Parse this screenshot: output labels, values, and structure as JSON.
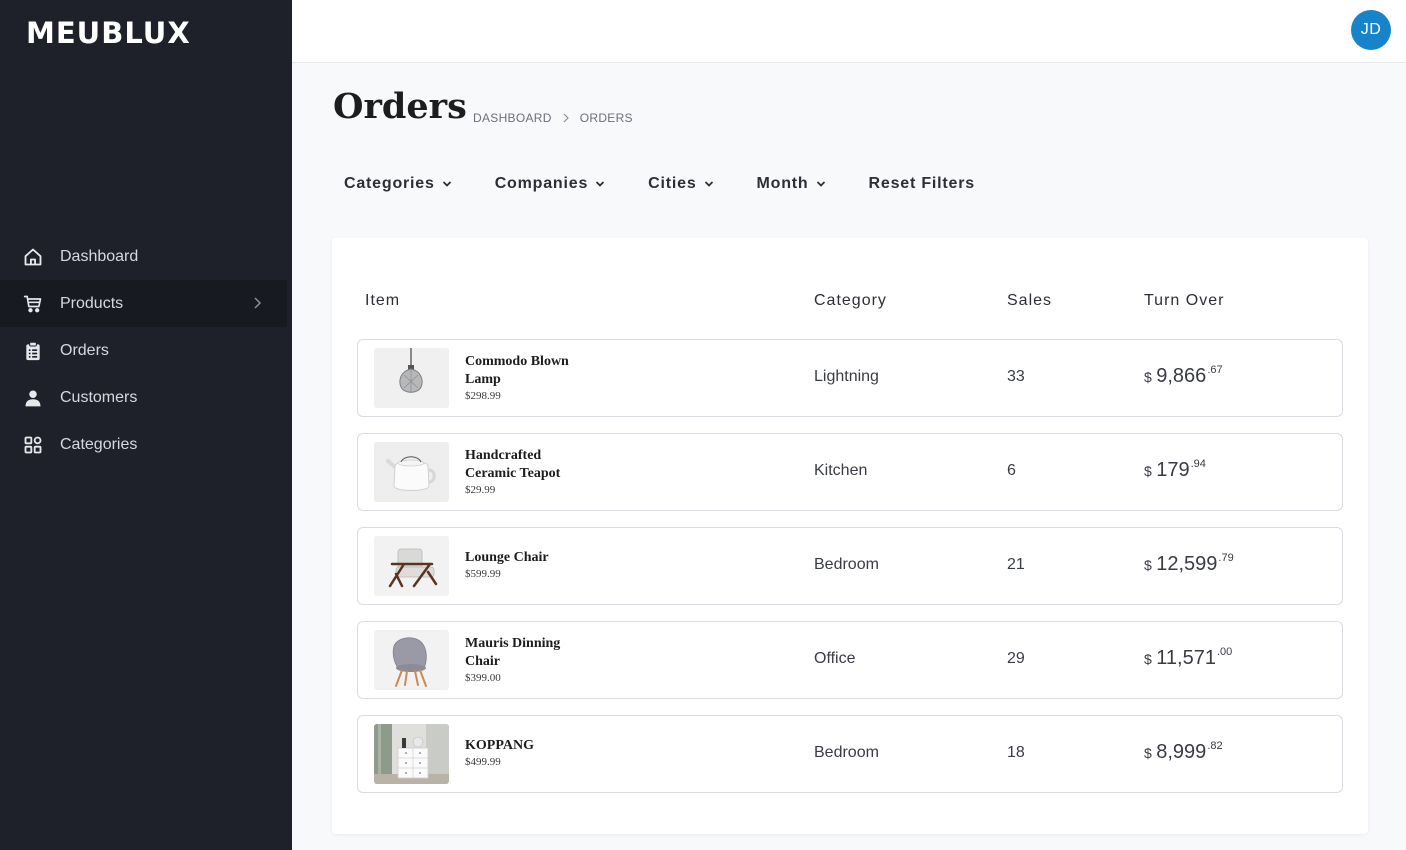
{
  "brand": "MEUBLUX",
  "user": {
    "initials": "JD"
  },
  "sidebar": {
    "items": [
      {
        "label": "Dashboard",
        "icon": "home-icon"
      },
      {
        "label": "Products",
        "icon": "cart-icon"
      },
      {
        "label": "Orders",
        "icon": "clipboard-icon"
      },
      {
        "label": "Customers",
        "icon": "user-icon"
      },
      {
        "label": "Categories",
        "icon": "grid-icon"
      }
    ]
  },
  "page": {
    "title": "Orders",
    "breadcrumb": [
      "DASHBOARD",
      "ORDERS"
    ]
  },
  "filters": {
    "categories": "Categories",
    "companies": "Companies",
    "cities": "Cities",
    "month": "Month",
    "reset": "Reset Filters"
  },
  "table": {
    "headers": {
      "item": "Item",
      "category": "Category",
      "sales": "Sales",
      "turnover": "Turn Over"
    },
    "rows": [
      {
        "name_line1": "Commodo Blown",
        "name_line2": "Lamp",
        "price": "$298.99",
        "category": "Lightning",
        "sales": "33",
        "currency": "$",
        "turnover_int": "9,866",
        "turnover_dec": ".67",
        "image": "pendant-lamp"
      },
      {
        "name_line1": "Handcrafted",
        "name_line2": "Ceramic Teapot",
        "price": "$29.99",
        "category": "Kitchen",
        "sales": "6",
        "currency": "$",
        "turnover_int": "179",
        "turnover_dec": ".94",
        "image": "teapot"
      },
      {
        "name_line1": "Lounge Chair",
        "name_line2": "",
        "price": "$599.99",
        "category": "Bedroom",
        "sales": "21",
        "currency": "$",
        "turnover_int": "12,599",
        "turnover_dec": ".79",
        "image": "lounge-chair"
      },
      {
        "name_line1": "Mauris Dinning",
        "name_line2": "Chair",
        "price": "$399.00",
        "category": "Office",
        "sales": "29",
        "currency": "$",
        "turnover_int": "11,571",
        "turnover_dec": ".00",
        "image": "dining-chair"
      },
      {
        "name_line1": "KOPPANG",
        "name_line2": "",
        "price": "$499.99",
        "category": "Bedroom",
        "sales": "18",
        "currency": "$",
        "turnover_int": "8,999",
        "turnover_dec": ".82",
        "image": "dresser"
      }
    ]
  }
}
